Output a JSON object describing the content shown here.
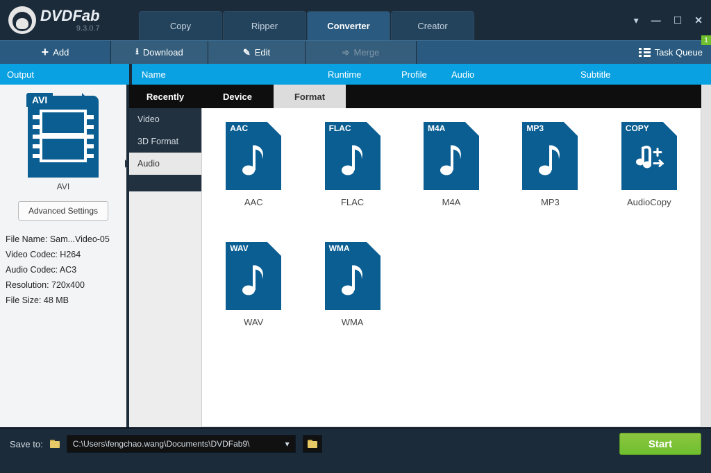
{
  "app": {
    "name": "DVDFab",
    "version": "9.3.0.7"
  },
  "mainTabs": [
    {
      "label": "Copy"
    },
    {
      "label": "Ripper"
    },
    {
      "label": "Converter",
      "active": true
    },
    {
      "label": "Creator"
    }
  ],
  "toolbar": {
    "add": "Add",
    "download": "Download",
    "edit": "Edit",
    "merge": "Merge",
    "task_queue": "Task Queue",
    "queue_count": "1"
  },
  "columns": {
    "output": "Output",
    "name": "Name",
    "runtime": "Runtime",
    "profile": "Profile",
    "audio": "Audio",
    "subtitle": "Subtitle"
  },
  "output": {
    "thumb_label": "AVI",
    "caption": "AVI",
    "advanced": "Advanced Settings",
    "file_name": "File Name: Sam...Video-05",
    "video_codec": "Video Codec: H264",
    "audio_codec": "Audio Codec: AC3",
    "resolution": "Resolution: 720x400",
    "file_size": "File Size: 48 MB"
  },
  "darkTabs": [
    {
      "label": "Recently"
    },
    {
      "label": "Device"
    },
    {
      "label": "Format",
      "active": true
    }
  ],
  "sideCats": [
    {
      "label": "Video"
    },
    {
      "label": "3D Format"
    },
    {
      "label": "Audio",
      "active": true
    }
  ],
  "formats": [
    {
      "badge": "AAC",
      "caption": "AAC",
      "type": "note"
    },
    {
      "badge": "FLAC",
      "caption": "FLAC",
      "type": "note"
    },
    {
      "badge": "M4A",
      "caption": "M4A",
      "type": "note"
    },
    {
      "badge": "MP3",
      "caption": "MP3",
      "type": "note"
    },
    {
      "badge": "COPY",
      "caption": "AudioCopy",
      "type": "copy"
    },
    {
      "badge": "WAV",
      "caption": "WAV",
      "type": "note"
    },
    {
      "badge": "WMA",
      "caption": "WMA",
      "type": "note"
    }
  ],
  "footer": {
    "save_to": "Save to:",
    "path": "C:\\Users\\fengchao.wang\\Documents\\DVDFab9\\",
    "start": "Start"
  }
}
